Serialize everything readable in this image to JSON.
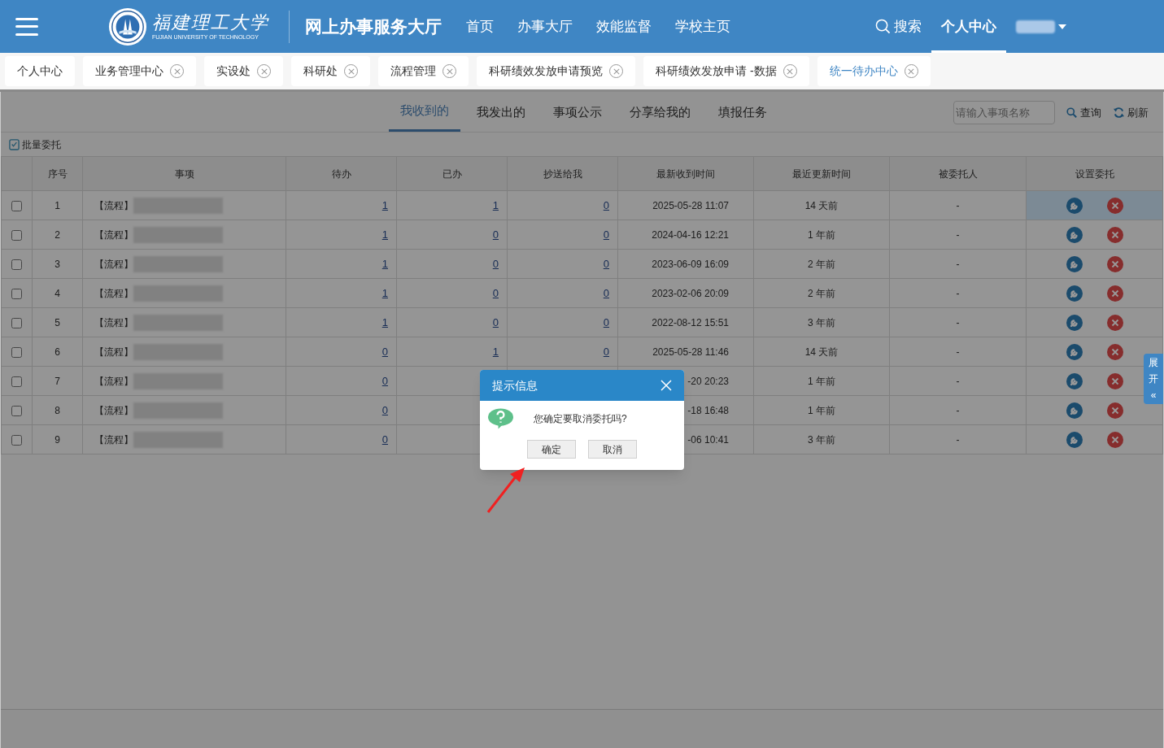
{
  "header": {
    "logo_name": "福建理工大学",
    "logo_sub": "FUJIAN UNIVERSITY OF TECHNOLOGY",
    "site_title": "网上办事服务大厅",
    "nav": [
      {
        "label": "首页",
        "selected": false
      },
      {
        "label": "办事大厅",
        "selected": false
      },
      {
        "label": "效能监督",
        "selected": false
      },
      {
        "label": "学校主页",
        "selected": false
      }
    ],
    "nav_right": [
      {
        "kind": "search",
        "label": "搜索",
        "selected": false
      },
      {
        "kind": "link",
        "label": "个人中心",
        "selected": true
      }
    ],
    "user": {
      "redacted": true
    }
  },
  "open_tabs": [
    {
      "label": "个人中心",
      "closable": false,
      "selected": false
    },
    {
      "label": "业务管理中心",
      "closable": true,
      "selected": false
    },
    {
      "label": "实设处",
      "closable": true,
      "selected": false
    },
    {
      "label": "科研处",
      "closable": true,
      "selected": false
    },
    {
      "label": "流程管理",
      "closable": true,
      "selected": false
    },
    {
      "label": "科研绩效发放申请预览",
      "closable": true,
      "selected": false
    },
    {
      "label": "科研绩效发放申请 -数据",
      "closable": true,
      "selected": false
    },
    {
      "label": "统一待办中心",
      "closable": true,
      "selected": true
    }
  ],
  "content": {
    "sub_tabs": [
      {
        "label": "我收到的",
        "selected": true
      },
      {
        "label": "我发出的",
        "selected": false
      },
      {
        "label": "事项公示",
        "selected": false
      },
      {
        "label": "分享给我的",
        "selected": false
      },
      {
        "label": "填报任务",
        "selected": false
      }
    ],
    "search": {
      "placeholder": "请输入事项名称"
    },
    "query_button": "查询",
    "refresh_button": "刷新",
    "batch_button": "批量委托",
    "table": {
      "columns": [
        "序号",
        "事项",
        "待办",
        "已办",
        "抄送给我",
        "最新收到时间",
        "最近更新时间",
        "被委托人",
        "设置委托"
      ],
      "rows": [
        {
          "checked": false,
          "selected": true,
          "index": "1",
          "item": "【流程】",
          "redacted": true,
          "pending": "1",
          "done": "1",
          "cc": "0",
          "received": "2025-05-28 11:07",
          "updated": "14 天前",
          "delegate": "-"
        },
        {
          "checked": false,
          "selected": false,
          "index": "2",
          "item": "【流程】",
          "redacted": true,
          "pending": "1",
          "done": "0",
          "cc": "0",
          "received": "2024-04-16 12:21",
          "updated": "1 年前",
          "delegate": "-"
        },
        {
          "checked": false,
          "selected": false,
          "index": "3",
          "item": "【流程】",
          "redacted": true,
          "pending": "1",
          "done": "0",
          "cc": "0",
          "received": "2023-06-09 16:09",
          "updated": "2 年前",
          "delegate": "-"
        },
        {
          "checked": false,
          "selected": false,
          "index": "4",
          "item": "【流程】",
          "redacted": true,
          "pending": "1",
          "done": "0",
          "cc": "0",
          "received": "2023-02-06 20:09",
          "updated": "2 年前",
          "delegate": "-"
        },
        {
          "checked": false,
          "selected": false,
          "index": "5",
          "item": "【流程】",
          "redacted": true,
          "pending": "1",
          "done": "0",
          "cc": "0",
          "received": "2022-08-12 15:51",
          "updated": "3 年前",
          "delegate": "-"
        },
        {
          "checked": false,
          "selected": false,
          "index": "6",
          "item": "【流程】",
          "redacted": true,
          "pending": "0",
          "done": "1",
          "cc": "0",
          "received": "2025-05-28 11:46",
          "updated": "14 天前",
          "delegate": "-"
        },
        {
          "checked": false,
          "selected": false,
          "index": "7",
          "item": "【流程】",
          "redacted": true,
          "pending": "0",
          "received": "-20 20:23",
          "updated": "1 年前",
          "delegate": "-"
        },
        {
          "checked": false,
          "selected": false,
          "index": "8",
          "item": "【流程】",
          "redacted": true,
          "pending": "0",
          "received": "-18 16:48",
          "updated": "1 年前",
          "delegate": "-"
        },
        {
          "checked": false,
          "selected": false,
          "index": "9",
          "item": "【流程】",
          "redacted": true,
          "pending": "0",
          "received": "-06 10:41",
          "updated": "3 年前",
          "delegate": "-"
        }
      ]
    }
  },
  "dialog": {
    "title": "提示信息",
    "message": "您确定要取消委托吗?",
    "buttons": [
      "确定",
      "取消"
    ]
  },
  "side_tab": {
    "line_1": "展",
    "line_2": "开",
    "arrows": "«"
  }
}
